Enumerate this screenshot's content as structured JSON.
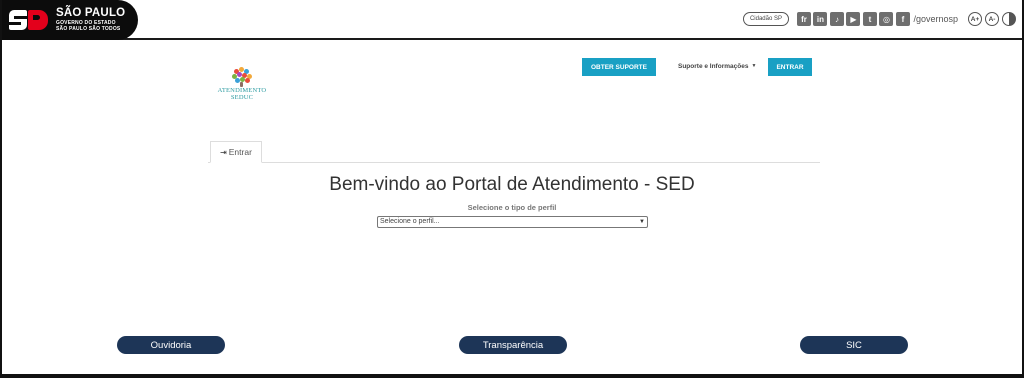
{
  "gov_bar": {
    "logo_title": "SÃO PAULO",
    "logo_sub1": "GOVERNO DO ESTADO",
    "logo_sub2": "SÃO PAULO SÃO TODOS",
    "cidadao_label": "Cidadão SP",
    "social": [
      {
        "icon": "flickr-icon",
        "glyph": "fr"
      },
      {
        "icon": "linkedin-icon",
        "glyph": "in"
      },
      {
        "icon": "tiktok-icon",
        "glyph": "♪"
      },
      {
        "icon": "youtube-icon",
        "glyph": "▶"
      },
      {
        "icon": "twitter-icon",
        "glyph": "t"
      },
      {
        "icon": "instagram-icon",
        "glyph": "◎"
      },
      {
        "icon": "facebook-icon",
        "glyph": "f"
      }
    ],
    "handle": "/governosp",
    "accessibility": {
      "increase": "A+",
      "decrease": "A-",
      "contrast_icon": "contrast-icon"
    }
  },
  "header": {
    "brand_line1": "ATENDIMENTO",
    "brand_line2": "SEDUC",
    "support_button": "OBTER SUPORTE",
    "nav_support": "Suporte e Informações",
    "login_button": "ENTRAR"
  },
  "tabs": [
    {
      "label": "Entrar",
      "icon": "sign-in-icon"
    }
  ],
  "main": {
    "title": "Bem-vindo ao Portal de Atendimento - SED",
    "subtitle": "Selecione o tipo de perfil",
    "select_value": "Selecione o perfil..."
  },
  "footer": {
    "ouvidoria": "Ouvidoria",
    "transparencia": "Transparência",
    "sic": "SIC"
  },
  "colors": {
    "accent": "#19a0c4",
    "footer_button": "#1d3557",
    "brand_red": "#e3001b",
    "brand_teal": "#2a9aa0"
  }
}
